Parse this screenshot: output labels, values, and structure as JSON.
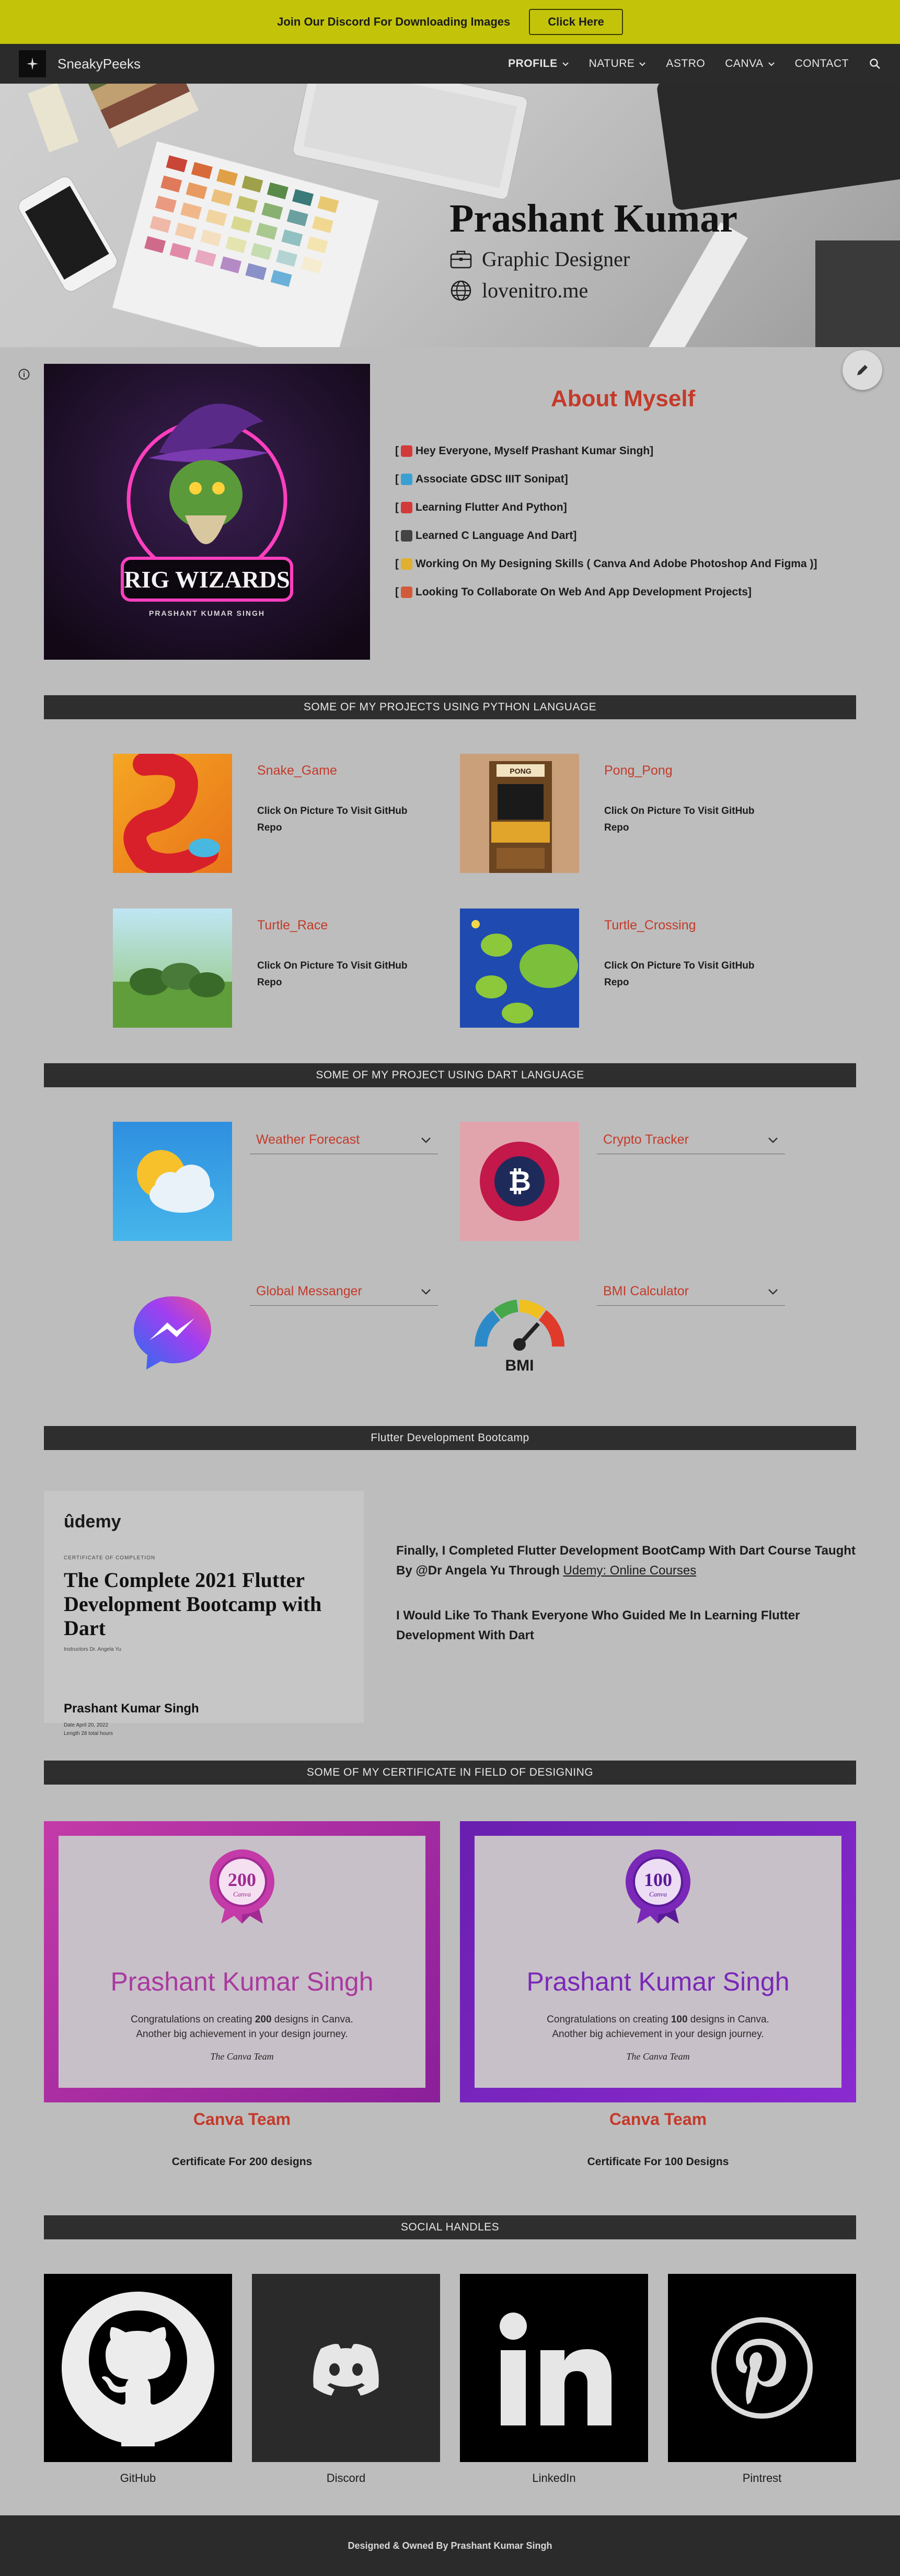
{
  "announcement": {
    "text": "Join Our Discord For Downloading Images",
    "button": "Click Here"
  },
  "nav": {
    "site_name": "SneakyPeeks",
    "items": [
      {
        "label": "PROFILE",
        "dropdown": true,
        "active": true
      },
      {
        "label": "NATURE",
        "dropdown": true
      },
      {
        "label": "ASTRO",
        "dropdown": false
      },
      {
        "label": "CANVA",
        "dropdown": true
      },
      {
        "label": "CONTACT",
        "dropdown": false
      }
    ],
    "search_icon": "search-icon"
  },
  "hero": {
    "name": "Prashant Kumar",
    "role": "Graphic Designer",
    "website": "lovenitro.me"
  },
  "about": {
    "title": "About Myself",
    "image_title": "RIG WIZARDS",
    "image_subtitle": "PRASHANT KUMAR SINGH",
    "items": [
      {
        "text": "Hey Everyone, Myself Prashant Kumar Singh]",
        "emoji_color": "#d23a3a"
      },
      {
        "text": "Associate GDSC IIIT Sonipat]",
        "emoji_color": "#3aa0d2"
      },
      {
        "text": "Learning Flutter And Python]",
        "emoji_color": "#d23a3a"
      },
      {
        "text": "Learned C Language And Dart]",
        "emoji_color": "#444444"
      },
      {
        "text": "Working On My Designing Skills ( Canva And Adobe Photoshop And Figma )]",
        "emoji_color": "#e0b030"
      },
      {
        "text": "Looking To Collaborate On Web And App Development Projects]",
        "emoji_color": "#d25a3a"
      }
    ]
  },
  "python_section": {
    "title": "SOME OF MY PROJECTS USING PYTHON LANGUAGE",
    "projects": [
      {
        "name": "Snake_Game",
        "desc": "Click On Picture To Visit GitHub Repo"
      },
      {
        "name": "Pong_Pong",
        "desc": "Click On Picture To Visit GitHub Repo",
        "image_text": "PONG"
      },
      {
        "name": "Turtle_Race",
        "desc": "Click On Picture To Visit GitHub Repo"
      },
      {
        "name": "Turtle_Crossing",
        "desc": "Click On Picture To Visit GitHub Repo"
      }
    ]
  },
  "dart_section": {
    "title": "SOME OF MY PROJECT USING DART LANGUAGE",
    "projects": [
      {
        "name": "Weather Forecast"
      },
      {
        "name": "Crypto Tracker"
      },
      {
        "name": "Global Messanger"
      },
      {
        "name": "BMI Calculator",
        "image_text": "BMI"
      }
    ]
  },
  "bootcamp": {
    "title": "Flutter Development Bootcamp",
    "cert": {
      "brand": "ûdemy",
      "label": "CERTIFICATE OF COMPLETION",
      "course": "The Complete 2021 Flutter Development Bootcamp with Dart",
      "instructor": "Instructors  Dr. Angela Yu",
      "name": "Prashant Kumar Singh",
      "date": "Date  April 20, 2022",
      "length": "Length  28 total hours"
    },
    "text1_before": "Finally, I Completed Flutter Development BootCamp With Dart Course Taught By @Dr Angela Yu Through ",
    "text1_link": "Udemy: Online Courses",
    "text2": "I Would Like To Thank Everyone Who Guided Me In Learning Flutter Development With Dart"
  },
  "design_section": {
    "title": "SOME OF MY CERTIFICATE IN FIELD OF DESIGNING",
    "certs": [
      {
        "badge_number": "200",
        "badge_word": "Canva",
        "name": "Prashant Kumar Singh",
        "congrats_pre": "Congratulations on creating ",
        "congrats_num": "200",
        "congrats_post": " designs in Canva.",
        "congrats_line2": "Another big achievement in your design journey.",
        "signature": "The Canva Team",
        "team": "Canva Team",
        "caption": "Certificate For 200 designs",
        "accent": "#b0369c",
        "name_color": "#a83aa0"
      },
      {
        "badge_number": "100",
        "badge_word": "Canva",
        "name": "Prashant Kumar Singh",
        "congrats_pre": "Congratulations on creating ",
        "congrats_num": "100",
        "congrats_post": " designs in Canva.",
        "congrats_line2": "Another big achievement in your design journey.",
        "signature": "The Canva Team",
        "team": "Canva Team",
        "caption": "Certificate For 100 Designs",
        "accent": "#7a1fb0",
        "name_color": "#7a28b8"
      }
    ]
  },
  "social_section": {
    "title": "SOCIAL HANDLES",
    "items": [
      {
        "label": "GitHub",
        "icon": "github-icon"
      },
      {
        "label": "Discord",
        "icon": "discord-icon"
      },
      {
        "label": "LinkedIn",
        "icon": "linkedin-icon"
      },
      {
        "label": "Pintrest",
        "icon": "pinterest-icon"
      }
    ]
  },
  "footer": {
    "text": "Designed & Owned By Prashant Kumar Singh"
  },
  "colors": {
    "accent_red": "#c43a2a",
    "announce_bg": "#c3c40a",
    "bar_bg": "#2e2e2e"
  }
}
